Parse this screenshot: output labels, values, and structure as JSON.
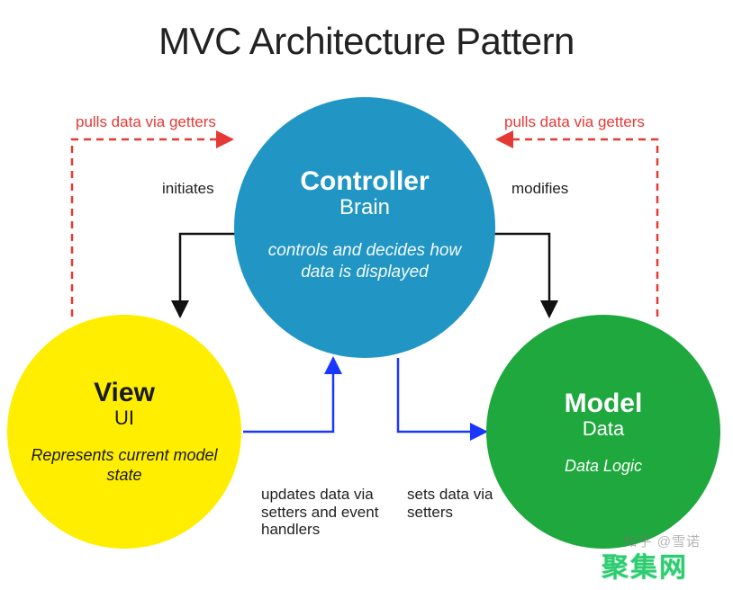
{
  "title": "MVC Architecture Pattern",
  "nodes": {
    "controller": {
      "title": "Controller",
      "subtitle": "Brain",
      "desc": "controls and decides how data is displayed"
    },
    "view": {
      "title": "View",
      "subtitle": "UI",
      "desc": "Represents current model state"
    },
    "model": {
      "title": "Model",
      "subtitle": "Data",
      "desc": "Data Logic"
    }
  },
  "edges": {
    "view_to_controller_getters": "pulls data via getters",
    "controller_to_view_initiates": "initiates",
    "view_to_controller_update": "updates data via setters and event handlers",
    "controller_to_model_set": "sets data via setters",
    "controller_to_model_modifies": "modifies",
    "model_to_controller_getters": "pulls data via getters"
  },
  "colors": {
    "controller": "#2196c4",
    "view": "#ffee00",
    "model": "#1ea83d",
    "red": "#e53935",
    "blue": "#1a37ff",
    "black": "#111111"
  },
  "watermarks": {
    "zhihu": "知乎 @雪诺",
    "site": "聚集网"
  }
}
